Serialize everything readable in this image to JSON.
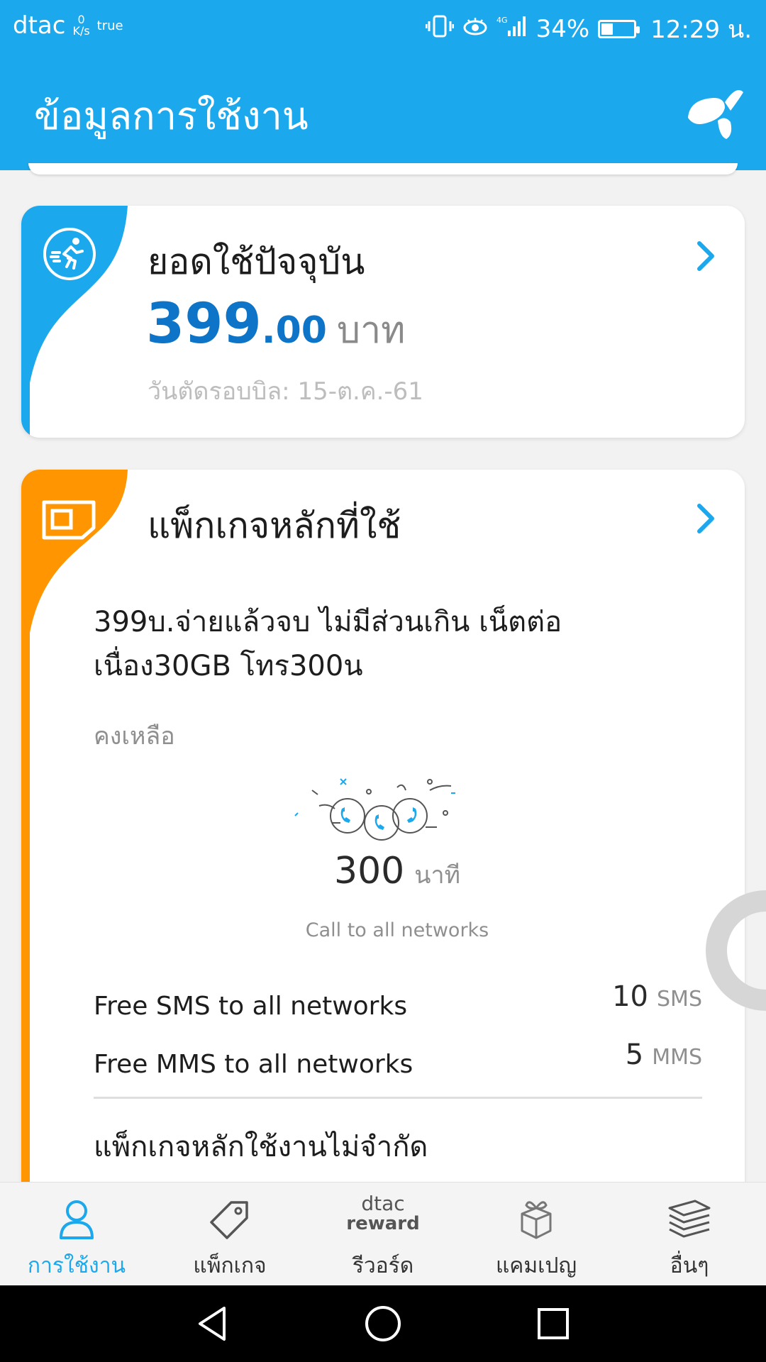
{
  "status_bar": {
    "carrier": "dtac",
    "net_speed_value": "0",
    "net_speed_unit": "K/s",
    "second_carrier": "true",
    "network_type": "4G",
    "battery_percent": "34%",
    "battery_level": 0.34,
    "time": "12:29 น."
  },
  "header": {
    "title": "ข้อมูลการใช้งาน",
    "logo_icon": "dtac-logo-icon"
  },
  "current_usage_card": {
    "title": "ยอดใช้ปัจจุบัน",
    "amount_integer": "399",
    "amount_decimal": ".00",
    "currency": "บาท",
    "billing_date": "วันตัดรอบบิล: 15-ต.ค.-61",
    "accent_color": "#1ba8ec",
    "icon": "running-person-icon"
  },
  "main_package_card": {
    "title": "แพ็กเกจหลักที่ใช้",
    "package_name": "399บ.จ่ายแล้วจบ ไม่มีส่วนเกิน เน็ตต่อเนื่อง30GB โทร300น",
    "remaining_label": "คงเหลือ",
    "call_minutes": "300",
    "call_unit": "นาที",
    "call_description": "Call to all networks",
    "extras": [
      {
        "label": "Free SMS to all networks",
        "value": "10",
        "unit": "SMS"
      },
      {
        "label": "Free MMS to all networks",
        "value": "5",
        "unit": "MMS"
      }
    ],
    "unlimited_heading": "แพ็กเกจหลักใช้งานไม่จำกัด",
    "accent_color": "#ff9500",
    "icon": "sim-card-icon"
  },
  "bottom_nav": {
    "items": [
      {
        "label": "การใช้งาน",
        "icon": "person-icon",
        "active": true
      },
      {
        "label": "แพ็กเกจ",
        "icon": "tag-icon",
        "active": false
      },
      {
        "label": "รีวอร์ด",
        "icon": "dtac-reward-icon",
        "brand_top": "dtac",
        "brand_bottom": "reward",
        "active": false
      },
      {
        "label": "แคมเปญ",
        "icon": "gift-box-icon",
        "active": false
      },
      {
        "label": "อื่นๆ",
        "icon": "stack-icon",
        "active": false
      }
    ]
  },
  "colors": {
    "brand_blue": "#1ba8ec",
    "amount_blue": "#0d74c8",
    "package_orange": "#ff9500"
  }
}
